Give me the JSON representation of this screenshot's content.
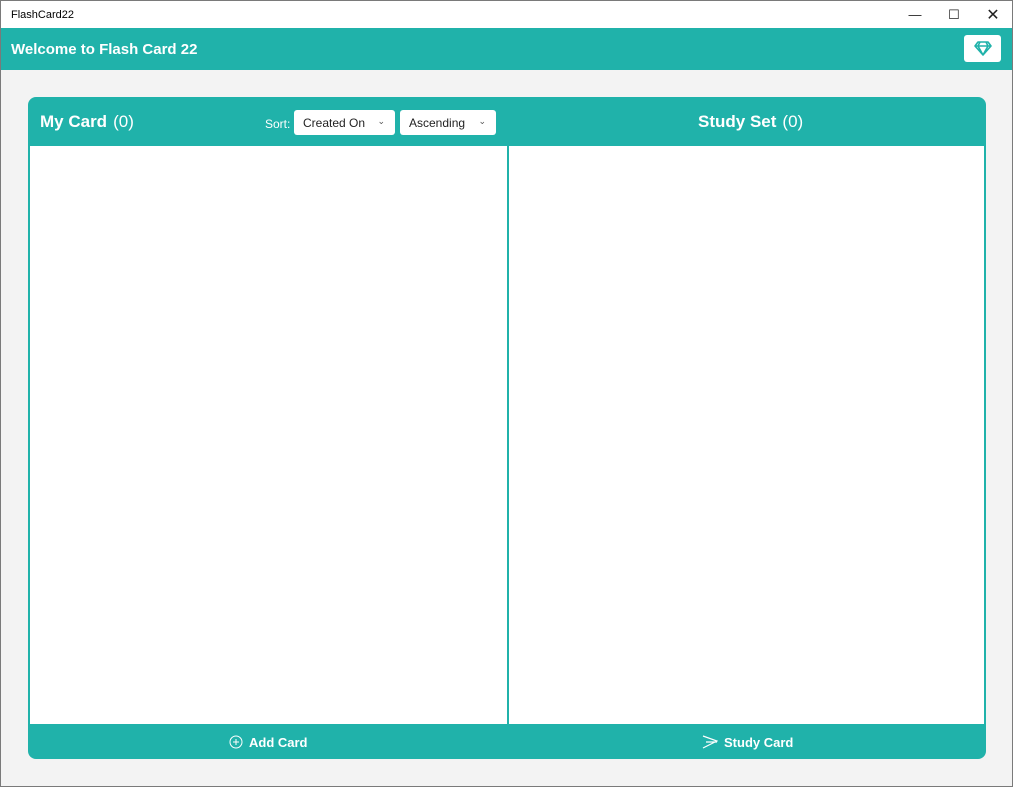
{
  "window": {
    "title": "FlashCard22"
  },
  "header": {
    "title": "Welcome to Flash Card 22",
    "premium_icon": "diamond-icon"
  },
  "my_card": {
    "title": "My Card",
    "count": "(0)",
    "sort_label": "Sort:",
    "sort_field": "Created On",
    "sort_order": "Ascending"
  },
  "study_set": {
    "title": "Study Set",
    "count": "(0)"
  },
  "footer": {
    "add_card": "Add Card",
    "study_card": "Study Card"
  },
  "colors": {
    "accent": "#20b2aa",
    "background": "#f3f3f3"
  }
}
